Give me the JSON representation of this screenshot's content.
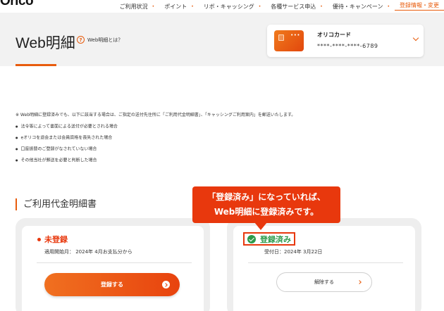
{
  "brand": {
    "logo": "Orico"
  },
  "nav": {
    "items": [
      {
        "label": "ご利用状況"
      },
      {
        "label": "ポイント"
      },
      {
        "label": "リボ・キャッシング"
      },
      {
        "label": "各種サービス申込"
      },
      {
        "label": "優待・キャンペーン"
      },
      {
        "label": "登録情報・変更"
      }
    ],
    "bullet": "•"
  },
  "header": {
    "title": "Web明細",
    "help_icon": "?",
    "help_label": "Web明細とは？"
  },
  "card": {
    "name": "オリコカード",
    "number": "****-****-****-6789",
    "dots": "•••"
  },
  "notes": {
    "main": "※ Web明細に登録済みでも、以下に該当する場合は、ご指定の送付先住所に「ご利用代金明細書」、「キャッシングご利用案内」を郵送いたします。",
    "items": [
      "法令等によって書面による送付が必要とされる場合",
      "eオリコを退会または会員資格を喪失された場合",
      "口座振替のご登録がなされていない場合",
      "その他当社が郵送を必要と判断した場合"
    ]
  },
  "section": {
    "heading": "ご利用代金明細書"
  },
  "left_panel": {
    "status": "未登録",
    "start_month": "適用開始月： 2024年 4月お支払分から",
    "button": "登録する"
  },
  "right_panel": {
    "status": "登録済み",
    "accept_date": "受付日：2024年 3月22日",
    "button": "解除する"
  },
  "callout": {
    "line1": "「登録済み」になっていれば、",
    "line2": "Web明細に登録済みです。"
  },
  "colors": {
    "accent": "#e85c0d",
    "alert_red": "#e8380d",
    "success_green": "#2e9a4a",
    "header_bg": "#f2f2f2"
  }
}
